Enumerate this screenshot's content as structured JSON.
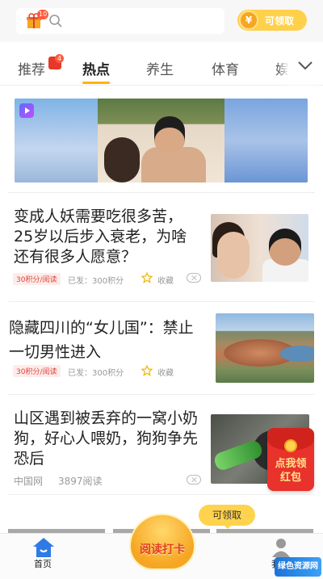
{
  "header": {
    "gift_badge": "10",
    "claim_label": "可领取",
    "coin_symbol": "¥"
  },
  "tabs": {
    "items": [
      {
        "label": "推荐",
        "badge": "4"
      },
      {
        "label": "热点"
      },
      {
        "label": "养生"
      },
      {
        "label": "体育"
      },
      {
        "label": "娱"
      }
    ],
    "active": "热点"
  },
  "feed": [
    {
      "title": "变成人妖需要吃很多苦，25岁以后步入衰老，为啥还有很多人愿意？",
      "points": "30积分/阅读",
      "published": "已发：300积分",
      "fav": "收藏"
    },
    {
      "title": "隐藏四川的“女儿国”：禁止一切男性进入",
      "points": "30积分/阅读",
      "published": "已发：300积分",
      "fav": "收藏"
    },
    {
      "title": "山区遇到被丢弃的一窝小奶狗，好心人喂奶，狗狗争先恐后",
      "source": "中国网",
      "reads": "3897阅读"
    }
  ],
  "redpack": {
    "text": "点我领红包"
  },
  "bubble": {
    "label": "可领取"
  },
  "checkin": {
    "label": "阅读打卡"
  },
  "bottom_nav": {
    "home": "首页",
    "me": "我的"
  },
  "watermark": "绿色资源网",
  "colors": {
    "accent": "#ffb400",
    "brand_red": "#e8322b",
    "points_red": "#e2443a"
  }
}
